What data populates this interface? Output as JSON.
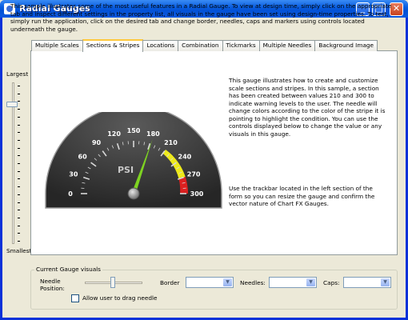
{
  "window": {
    "title": "Radial Gauges"
  },
  "intro": "This sample illustrates some of the most useful features in a Radial Gauge. To view at design time, simply click on the appropriate tab and inspect different settings in the property list, all visuals in the gauge have been set using design-time properties. To test, simply run the application, click on the desired tab and change border, needles, caps and markers using controls located underneath the gauge.",
  "tabs": [
    "Multiple Scales",
    "Sections & Stripes",
    "Locations",
    "Combination",
    "Tickmarks",
    "Multiple Needles",
    "Background Image"
  ],
  "active_tab": 1,
  "description": "This gauge illustrates how to create and customize scale sections and stripes. In this sample, a section has been created between values 210 and 300 to indicate warning levels to the user. The needle will change  colors according to the color of the stripe it is pointing to highlight the condition.  You can use the controls displayed below to change the value or any visuals in this gauge.",
  "description2": "Use the trackbar located in the left section of the form so you can resize the gauge and confirm the vector nature of Chart FX Gauges.",
  "gauge": {
    "scale_labels": [
      "0",
      "30",
      "60",
      "90",
      "120",
      "150",
      "180",
      "210",
      "240",
      "270",
      "300"
    ],
    "unit": "PSI",
    "needle_value": 182,
    "colors": {
      "background": "#3a3a3a",
      "needle": "#7ed321",
      "stripe_yellow": "#f2ee1a",
      "stripe_red": "#e02020"
    }
  },
  "size_trackbar": {
    "top_label": "Largest",
    "bottom_label": "Smallest",
    "level": 0.88
  },
  "visuals": {
    "group_title": "Current Gauge visuals",
    "needle_position_label": "Needle Position:",
    "needle_position_level": 0.48,
    "drag_checkbox": "Allow user to drag needle",
    "border_label": "Border",
    "needles_label": "Needles:",
    "caps_label": "Caps:"
  },
  "icons": [
    "app-icon",
    "minimize-icon",
    "maximize-icon",
    "close-icon",
    "dropdown-arrow-icon"
  ]
}
